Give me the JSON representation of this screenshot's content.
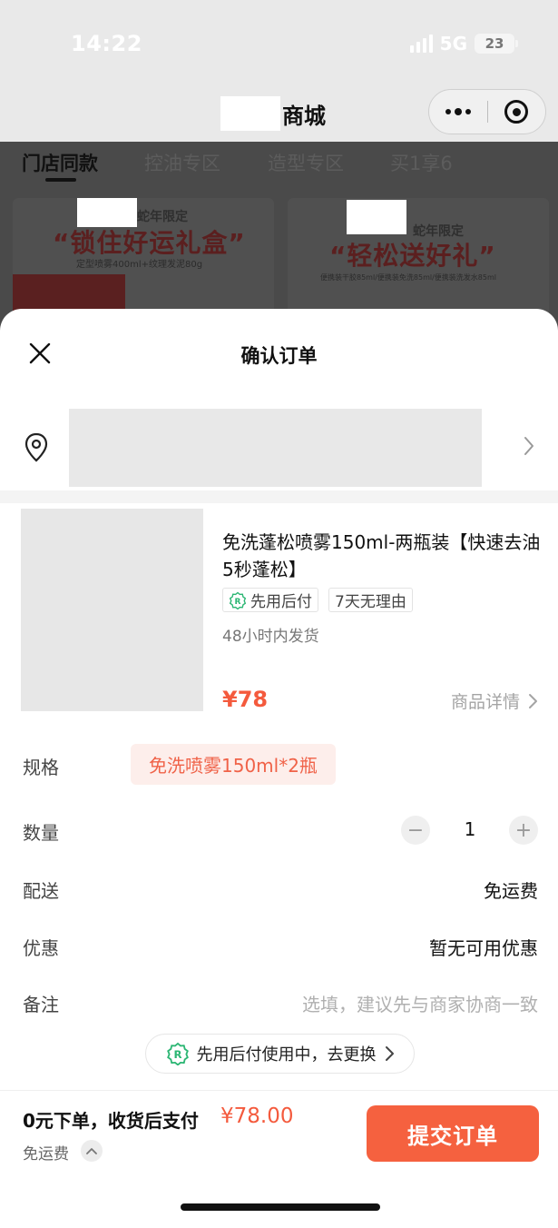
{
  "status_bar": {
    "time": "14:22",
    "network": "5G",
    "battery": "23"
  },
  "nav": {
    "title": "商城",
    "more_icon": "more-dots-icon",
    "close_icon": "target-circle-icon"
  },
  "tabs": [
    "门店同款",
    "控油专区",
    "造型专区",
    "买1享6"
  ],
  "banners": [
    {
      "tagline": "蛇年限定",
      "headline": "“锁住好运礼盒”",
      "sub": "定型喷雾400ml+纹理发泥80g"
    },
    {
      "tagline": "蛇年限定",
      "headline": "“轻松送好礼”",
      "sub": "便携装干胶85ml/便携装免洗85ml/便携装洗发水85ml"
    }
  ],
  "sheet": {
    "title": "确认订单"
  },
  "product": {
    "name": "免洗蓬松喷雾150ml-两瓶装【快速去油 5秒蓬松】",
    "tags": [
      "先用后付",
      "7天无理由"
    ],
    "shipping_note": "48小时内发货",
    "price": "¥78",
    "detail_link": "商品详情"
  },
  "rows": {
    "spec": {
      "label": "规格",
      "value": "免洗喷雾150ml*2瓶"
    },
    "quantity": {
      "label": "数量",
      "value": "1",
      "minus": "−",
      "plus": "+"
    },
    "delivery": {
      "label": "配送",
      "value": "免运费"
    },
    "discount": {
      "label": "优惠",
      "value": "暂无可用优惠"
    },
    "note": {
      "label": "备注",
      "placeholder": "选填，建议先与商家协商一致"
    }
  },
  "pay_later_pill": "先用后付使用中，去更换",
  "bottom": {
    "pay_text": "0元下单，收货后支付",
    "amount": "¥78.00",
    "shipping": "免运费",
    "submit": "提交订单"
  },
  "colors": {
    "accent": "#f45a3d",
    "chip_bg": "#fdeeeb",
    "pay_later_green": "#2bb673"
  }
}
